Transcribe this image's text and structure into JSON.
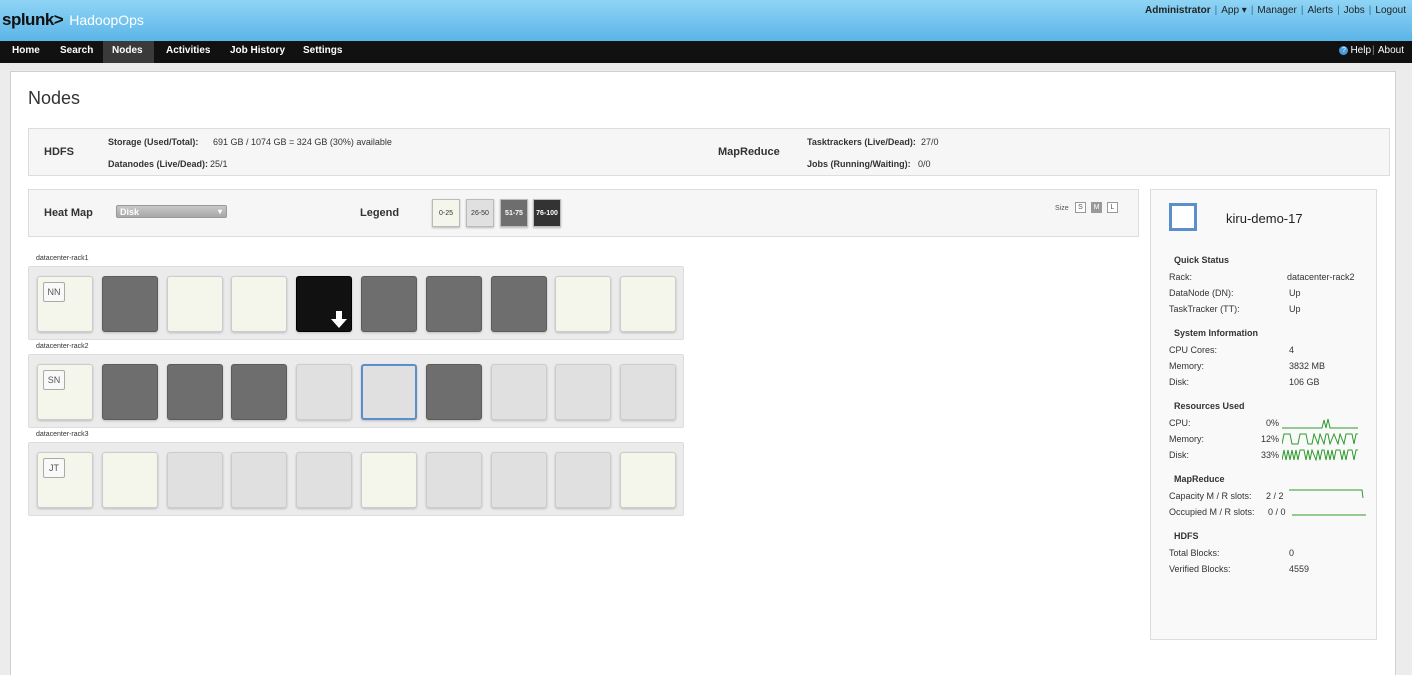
{
  "header": {
    "logo": "splunk>",
    "app_name": "HadoopOps",
    "account": {
      "user": "Administrator",
      "links": [
        "App ▾",
        "Manager",
        "Alerts",
        "Jobs",
        "Logout"
      ]
    }
  },
  "nav": {
    "items": [
      "Home",
      "Search",
      "Nodes",
      "Activities",
      "Job History",
      "Settings"
    ],
    "active": "Nodes",
    "help": "Help",
    "about": "About"
  },
  "page": {
    "title": "Nodes"
  },
  "summary": {
    "hdfs": {
      "title": "HDFS",
      "storage_label": "Storage (Used/Total):",
      "storage_value": "691 GB / 1074 GB = 324 GB (30%) available",
      "datanodes_label": "Datanodes (Live/Dead):",
      "datanodes_value": "25/1"
    },
    "mapreduce": {
      "title": "MapReduce",
      "tasktrackers_label": "Tasktrackers (Live/Dead):",
      "tasktrackers_value": "27/0",
      "jobs_label": "Jobs (Running/Waiting):",
      "jobs_value": "0/0"
    }
  },
  "heatmap": {
    "title": "Heat Map",
    "metric": "Disk",
    "legend_title": "Legend",
    "legend": [
      {
        "label": "0-25",
        "bg": "#f4f6ec",
        "fg": "#333333"
      },
      {
        "label": "26-50",
        "bg": "#e0e0e0",
        "fg": "#333333"
      },
      {
        "label": "51-75",
        "bg": "#6e6e6e",
        "fg": "#ffffff"
      },
      {
        "label": "76-100",
        "bg": "#333333",
        "fg": "#ffffff"
      }
    ],
    "size_label": "Size",
    "sizes": [
      "S",
      "M",
      "L"
    ],
    "size_selected": "M"
  },
  "racks": [
    {
      "name": "datacenter-rack1",
      "nodes": [
        {
          "level": 0,
          "tag": "NN"
        },
        {
          "level": 2
        },
        {
          "level": 0
        },
        {
          "level": 0
        },
        {
          "level": 3,
          "icon": "download-arrow-icon"
        },
        {
          "level": 2
        },
        {
          "level": 2
        },
        {
          "level": 2
        },
        {
          "level": 0
        },
        {
          "level": 0
        }
      ]
    },
    {
      "name": "datacenter-rack2",
      "nodes": [
        {
          "level": 0,
          "tag": "SN"
        },
        {
          "level": 2
        },
        {
          "level": 2
        },
        {
          "level": 2
        },
        {
          "level": 1
        },
        {
          "level": 1,
          "selected": true
        },
        {
          "level": 2
        },
        {
          "level": 1
        },
        {
          "level": 1
        },
        {
          "level": 1
        }
      ]
    },
    {
      "name": "datacenter-rack3",
      "nodes": [
        {
          "level": 0,
          "tag": "JT"
        },
        {
          "level": 0
        },
        {
          "level": 1
        },
        {
          "level": 1
        },
        {
          "level": 1
        },
        {
          "level": 0
        },
        {
          "level": 1
        },
        {
          "level": 1
        },
        {
          "level": 1
        },
        {
          "level": 0
        }
      ]
    }
  ],
  "detail": {
    "name": "kiru-demo-17",
    "quick_status": {
      "title": "Quick Status",
      "rows": [
        {
          "label": "Rack:",
          "value": "datacenter-rack2"
        },
        {
          "label": "DataNode (DN):",
          "value": "Up"
        },
        {
          "label": "TaskTracker (TT):",
          "value": "Up"
        }
      ]
    },
    "system": {
      "title": "System Information",
      "rows": [
        {
          "label": "CPU Cores:",
          "value": "4"
        },
        {
          "label": "Memory:",
          "value": "3832 MB"
        },
        {
          "label": "Disk:",
          "value": "106 GB"
        }
      ]
    },
    "resources": {
      "title": "Resources Used",
      "rows": [
        {
          "label": "CPU:",
          "value": "0%"
        },
        {
          "label": "Memory:",
          "value": "12%"
        },
        {
          "label": "Disk:",
          "value": "33%"
        }
      ]
    },
    "mapreduce": {
      "title": "MapReduce",
      "rows": [
        {
          "label": "Capacity M / R slots:",
          "value": "2 / 2"
        },
        {
          "label": "Occupied M / R slots:",
          "value": "0 / 0"
        }
      ]
    },
    "hdfs": {
      "title": "HDFS",
      "rows": [
        {
          "label": "Total Blocks:",
          "value": "0"
        },
        {
          "label": "Verified Blocks:",
          "value": "4559"
        }
      ]
    }
  },
  "colors": {
    "accent": "#5b8fcb",
    "sparkline": "#2e9a2e",
    "header_top": "#8fd4f5",
    "header_bottom": "#5bb5e8"
  }
}
